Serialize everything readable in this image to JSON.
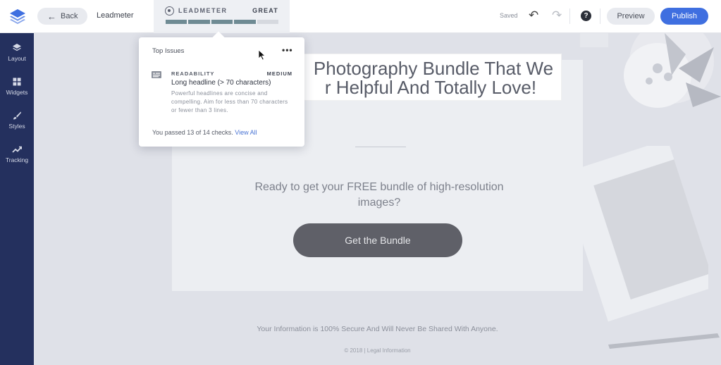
{
  "topbar": {
    "back_label": "Back",
    "page_name": "Leadmeter",
    "leadmeter": {
      "label": "LEADMETER",
      "grade": "GREAT",
      "score_segments": 5,
      "filled_segments": 4
    },
    "saved_label": "Saved",
    "preview_label": "Preview",
    "publish_label": "Publish"
  },
  "sidebar": {
    "items": [
      {
        "label": "Layout",
        "icon": "layers-icon"
      },
      {
        "label": "Widgets",
        "icon": "widgets-icon"
      },
      {
        "label": "Styles",
        "icon": "brush-icon"
      },
      {
        "label": "Tracking",
        "icon": "trend-icon"
      }
    ]
  },
  "popover": {
    "title": "Top Issues",
    "issue": {
      "category": "READABILITY",
      "severity": "MEDIUM",
      "headline": "Long headline (> 70 characters)",
      "description": "Powerful headlines are concise and compelling. Aim for less than 70 characters or fewer than 3 lines."
    },
    "footer_text": "You passed 13 of 14 checks.",
    "footer_link": "View All"
  },
  "page": {
    "headline_line1": "Photography Bundle That We",
    "headline_line2": "r Helpful And Totally Love!",
    "subtext": "Ready to get your FREE bundle of high-resolution images?",
    "cta_label": "Get the Bundle",
    "secure_text": "Your Information is 100% Secure And Will Never Be Shared With Anyone.",
    "legal_text": "© 2018 | Legal Information"
  },
  "colors": {
    "sidebar": "#24305e",
    "publish": "#3f6fe0",
    "meter_fill": "#6f8b94",
    "cta": "#5f6068"
  }
}
